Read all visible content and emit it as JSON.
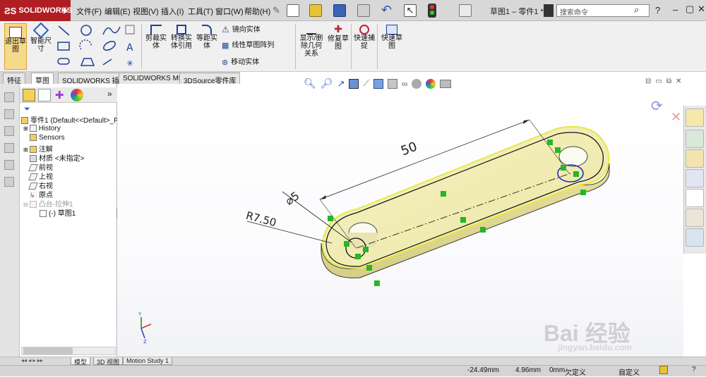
{
  "app": {
    "logo_text": "SOLIDWORKS",
    "doc_title": "草图1 – 零件1 *"
  },
  "menu": [
    "文件(F)",
    "编辑(E)",
    "视图(V)",
    "插入(I)",
    "工具(T)",
    "窗口(W)",
    "帮助(H)"
  ],
  "search": {
    "placeholder": "搜索命令"
  },
  "ribbon": {
    "exit_sketch": "退出草图",
    "smart_dim": "智能尺寸",
    "trim": "剪裁实体",
    "convert": "转换实体引用",
    "offset": "等距实体",
    "mirror": "镜向实体",
    "linear_pattern": "线性草图阵列",
    "move": "移动实体",
    "relations": "显示/删除几何关系",
    "repair": "修复草图",
    "quick_snap": "快速捕捉",
    "rapid_sketch": "快速草图"
  },
  "tabs": [
    "特征",
    "草图",
    "SOLIDWORKS 插件",
    "SOLIDWORKS MBD",
    "3DSource零件库"
  ],
  "active_tab": "草图",
  "tree": {
    "root": "零件1  (Default<<Default>_P",
    "items": [
      "History",
      "Sensors",
      "注解",
      "材质 <未指定>",
      "前视",
      "上视",
      "右视",
      "原点",
      "凸台-拉伸1",
      "(-) 草图1"
    ]
  },
  "dimensions": {
    "length": "50",
    "diameter": "⌀5",
    "radius": "R7.50"
  },
  "bottom_tabs": [
    "模型",
    "3D 视图",
    "Motion Study 1"
  ],
  "status": {
    "x": "-24.49mm",
    "y": "4.96mm",
    "z": "0mm",
    "state": "欠定义",
    "mode": "自定义"
  },
  "watermark": {
    "brand": "Bai  经验",
    "url": "jingyan.baidu.com"
  },
  "colors": {
    "accent": "#b01e24",
    "model_fill": "#efeaa6",
    "model_edge": "#e8e84a",
    "relation": "#26b626",
    "circle": "#1f2fbf"
  }
}
